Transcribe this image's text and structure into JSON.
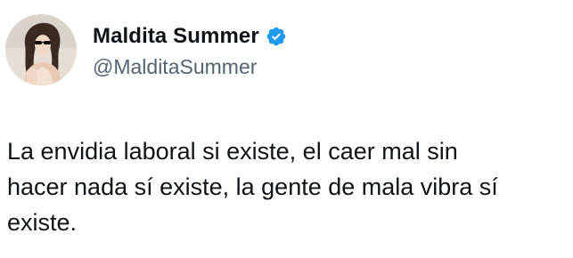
{
  "tweet": {
    "author": {
      "display_name": "Maldita Summer",
      "handle": "@MalditaSummer",
      "verified_icon": "verified-badge-icon",
      "avatar": "avatar-photo"
    },
    "text": "La envidia laboral si existe, el caer mal sin\nhacer nada sí existe, la gente de mala vibra sí\nexiste."
  },
  "colors": {
    "verified_blue": "#1d9bf0",
    "text": "#0f1419",
    "secondary_text": "#536471",
    "background": "#ffffff"
  }
}
